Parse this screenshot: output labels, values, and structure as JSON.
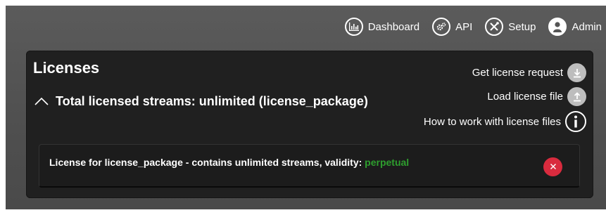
{
  "nav": {
    "items": [
      {
        "label": "Dashboard",
        "icon": "dashboard-chart-icon"
      },
      {
        "label": "API",
        "icon": "gears-icon"
      },
      {
        "label": "Setup",
        "icon": "tools-icon"
      },
      {
        "label": "Admin",
        "icon": "user-icon"
      }
    ]
  },
  "panel": {
    "title": "Licenses",
    "summary": "Total licensed streams: unlimited (license_package)",
    "actions": [
      {
        "label": "Get license request",
        "icon": "download-icon"
      },
      {
        "label": "Load license file",
        "icon": "upload-icon"
      },
      {
        "label": "How to work with license files",
        "icon": "info-icon"
      }
    ]
  },
  "license": {
    "text": "License for license_package - contains unlimited streams, validity: ",
    "validity": "perpetual",
    "validity_color": "#2e9e2e",
    "remove_color": "#d92b3e"
  }
}
